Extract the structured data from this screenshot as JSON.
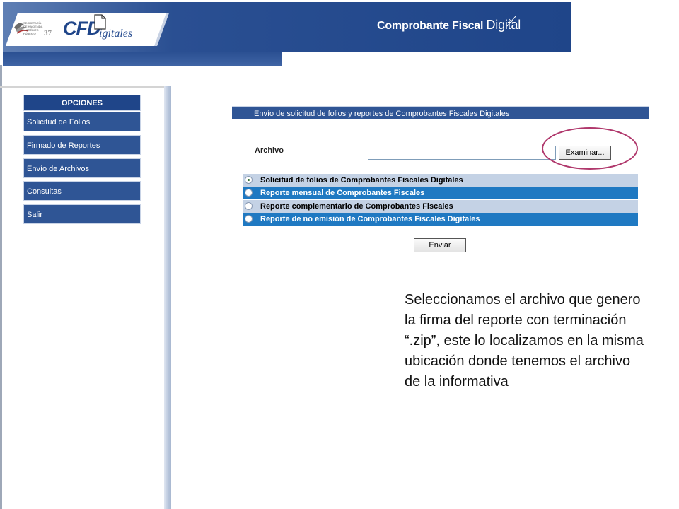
{
  "header": {
    "seal_text": "SECRETARÍA DE HACIENDA Y CRÉDITO PÚBLICO",
    "seal_number": "37",
    "logo_main": "CFD",
    "logo_suffix": "igitales",
    "title_bold": "Comprobante Fiscal",
    "title_light": "Digital"
  },
  "sidebar": {
    "title": "OPCIONES",
    "items": [
      {
        "label": "Solicitud de Folios"
      },
      {
        "label": "Firmado de Reportes"
      },
      {
        "label": "Envío de Archivos"
      },
      {
        "label": "Consultas"
      },
      {
        "label": "Salir"
      }
    ]
  },
  "main": {
    "section_title": "Envío de solicitud de folios y reportes de Comprobantes Fiscales Digitales",
    "file_label": "Archivo",
    "file_value": "",
    "browse_label": "Examinar...",
    "options": [
      {
        "label": "Solicitud de folios de Comprobantes Fiscales Digitales",
        "checked": true
      },
      {
        "label": "Reporte mensual de Comprobantes Fiscales",
        "checked": false
      },
      {
        "label": "Reporte complementario de Comprobantes Fiscales",
        "checked": false
      },
      {
        "label": "Reporte de no emisión de Comprobantes Fiscales Digitales",
        "checked": false
      }
    ],
    "send_label": "Enviar"
  },
  "caption": "Seleccionamos el archivo que genero la firma del reporte con terminación “.zip”, este lo localizamos en la misma ubicación donde tenemos el archivo de la informativa",
  "colors": {
    "banner_blue": "#1f4589",
    "menu_blue": "#2f5595",
    "row_dark": "#1f79c2",
    "row_light": "#c4d2e5",
    "highlight": "#b0386c"
  }
}
